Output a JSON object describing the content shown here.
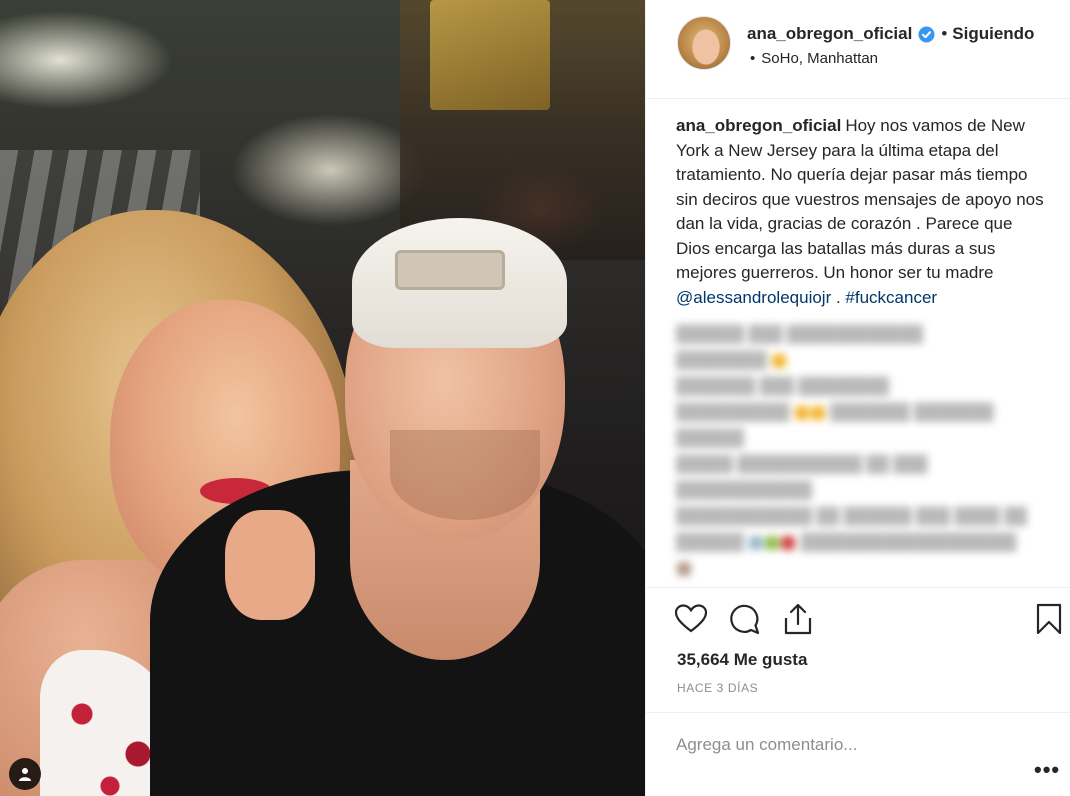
{
  "post": {
    "username": "ana_obregon_oficial",
    "verified": true,
    "separator": "•",
    "follow_status": "Siguiendo",
    "location_bullet": "•",
    "location": "SoHo, Manhattan",
    "caption_author": "ana_obregon_oficial",
    "caption_text": "Hoy nos vamos de New York a New Jersey para la última etapa del tratamiento. No quería dejar pasar más tiempo sin deciros que vuestros mensajes de apoyo nos dan la vida, gracias de corazón . Parece que Dios encarga las batallas más duras a sus mejores guerreros. Un honor ser tu madre",
    "caption_mention": "@alessandrolequiojr",
    "caption_between": " . ",
    "caption_hashtag": "#fuckcancer",
    "likes_text": "35,664 Me gusta",
    "time_ago": "HACE 3 DÍAS",
    "comment_placeholder": "Agrega un comentario...",
    "more_options": "•••"
  },
  "icons": {
    "verified": "verified-badge-icon",
    "like": "heart-icon",
    "comment": "comment-bubble-icon",
    "share": "share-icon",
    "save": "bookmark-icon",
    "user_tag": "person-icon"
  },
  "colors": {
    "link": "#00376b",
    "verified": "#3897f0",
    "muted": "#8e8e8e",
    "text": "#262626"
  }
}
